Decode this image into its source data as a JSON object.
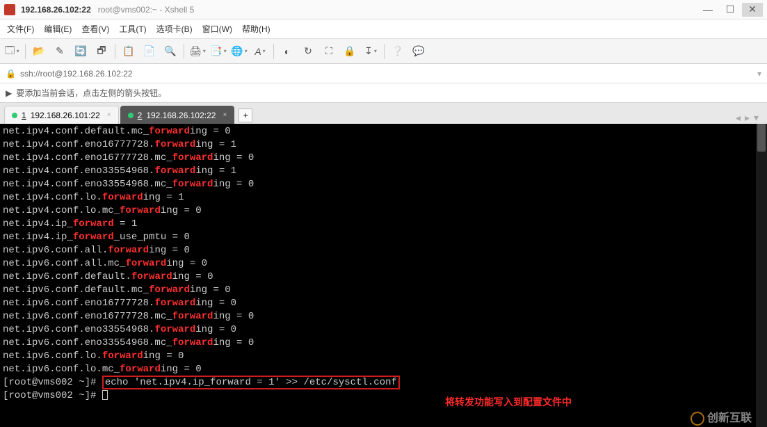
{
  "window": {
    "title_main": "192.168.26.102:22",
    "title_sub": "root@vms002:~ - Xshell 5",
    "controls": {
      "min": "—",
      "max": "☐",
      "close": "✕"
    }
  },
  "menu": {
    "file": "文件(F)",
    "edit": "编辑(E)",
    "view": "查看(V)",
    "tools": "工具(T)",
    "tab": "选项卡(B)",
    "window": "窗口(W)",
    "help": "帮助(H)"
  },
  "toolbar_icons": {
    "new_session": "new-session",
    "open": "open",
    "disconnect": "disconnect",
    "reconnect": "reconnect",
    "copy": "copy",
    "paste": "paste",
    "find": "find",
    "print": "print",
    "props": "properties",
    "globe": "toggle-char",
    "font": "font",
    "color": "color-scheme",
    "refresh": "refresh",
    "fullscreen": "fullscreen",
    "lock": "lock",
    "transfer": "transfer",
    "help": "help",
    "compose": "compose"
  },
  "addressbar": {
    "lock_icon": "🔒",
    "url": "ssh://root@192.168.26.102:22"
  },
  "hintbar": {
    "icon": "▶",
    "text": "要添加当前会话，点击左侧的箭头按钮。"
  },
  "tabs": [
    {
      "num": "1",
      "label": "192.168.26.101:22",
      "active": false
    },
    {
      "num": "2",
      "label": "192.168.26.102:22",
      "active": true
    }
  ],
  "nav_arrows": {
    "left": "◂",
    "right": "▸",
    "drop": "▾"
  },
  "terminal": {
    "lines": [
      {
        "pre": "net.ipv4.conf.default.mc_",
        "hl": "forward",
        "post": "ing = 0"
      },
      {
        "pre": "net.ipv4.conf.eno16777728.",
        "hl": "forward",
        "post": "ing = 1"
      },
      {
        "pre": "net.ipv4.conf.eno16777728.mc_",
        "hl": "forward",
        "post": "ing = 0"
      },
      {
        "pre": "net.ipv4.conf.eno33554968.",
        "hl": "forward",
        "post": "ing = 1"
      },
      {
        "pre": "net.ipv4.conf.eno33554968.mc_",
        "hl": "forward",
        "post": "ing = 0"
      },
      {
        "pre": "net.ipv4.conf.lo.",
        "hl": "forward",
        "post": "ing = 1"
      },
      {
        "pre": "net.ipv4.conf.lo.mc_",
        "hl": "forward",
        "post": "ing = 0"
      },
      {
        "pre": "net.ipv4.ip_",
        "hl": "forward",
        "post": " = 1"
      },
      {
        "pre": "net.ipv4.ip_",
        "hl": "forward",
        "post": "_use_pmtu = 0"
      },
      {
        "pre": "net.ipv6.conf.all.",
        "hl": "forward",
        "post": "ing = 0"
      },
      {
        "pre": "net.ipv6.conf.all.mc_",
        "hl": "forward",
        "post": "ing = 0"
      },
      {
        "pre": "net.ipv6.conf.default.",
        "hl": "forward",
        "post": "ing = 0"
      },
      {
        "pre": "net.ipv6.conf.default.mc_",
        "hl": "forward",
        "post": "ing = 0"
      },
      {
        "pre": "net.ipv6.conf.eno16777728.",
        "hl": "forward",
        "post": "ing = 0"
      },
      {
        "pre": "net.ipv6.conf.eno16777728.mc_",
        "hl": "forward",
        "post": "ing = 0"
      },
      {
        "pre": "net.ipv6.conf.eno33554968.",
        "hl": "forward",
        "post": "ing = 0"
      },
      {
        "pre": "net.ipv6.conf.eno33554968.mc_",
        "hl": "forward",
        "post": "ing = 0"
      },
      {
        "pre": "net.ipv6.conf.lo.",
        "hl": "forward",
        "post": "ing = 0"
      },
      {
        "pre": "net.ipv6.conf.lo.mc_",
        "hl": "forward",
        "post": "ing = 0"
      }
    ],
    "prompt1": "[root@vms002 ~]# ",
    "echo_cmd": "echo 'net.ipv4.ip_forward = 1' >> /etc/sysctl.conf",
    "annotation": "将转发功能写入到配置文件中",
    "prompt2": "[root@vms002 ~]# "
  },
  "watermark": "创新互联"
}
